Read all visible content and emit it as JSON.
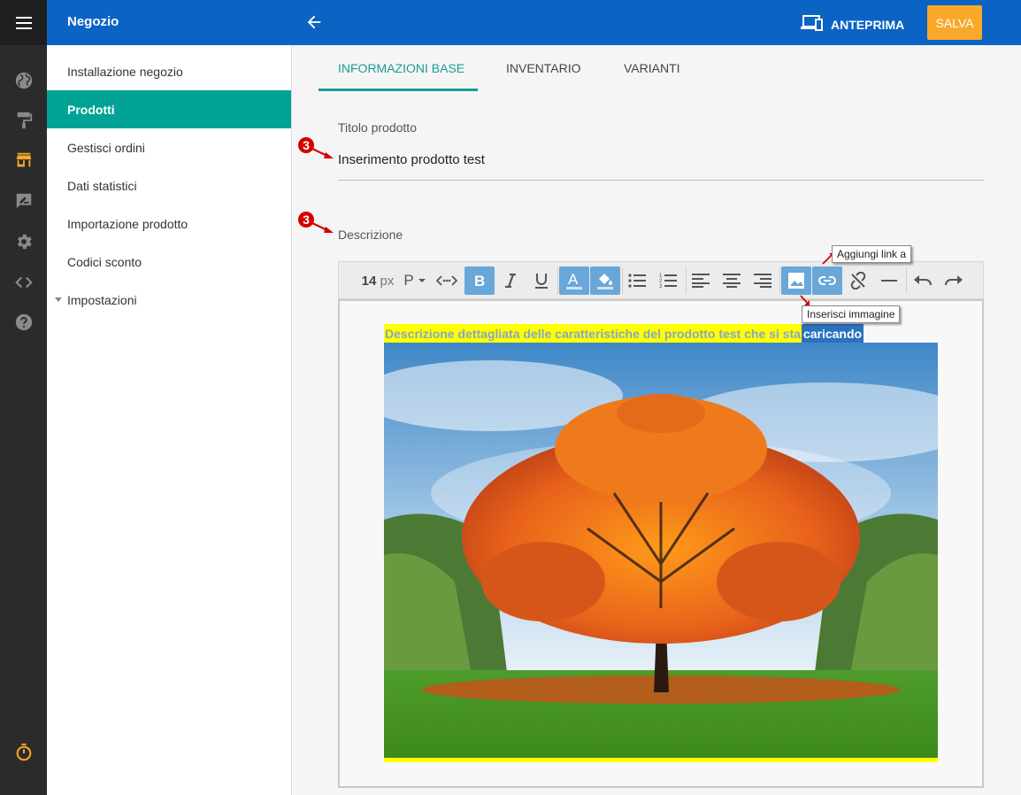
{
  "header": {
    "title": "Negozio",
    "preview_label": "ANTEPRIMA",
    "save_label": "SALVA"
  },
  "sidebar": {
    "items": [
      {
        "label": "Installazione negozio"
      },
      {
        "label": "Prodotti"
      },
      {
        "label": "Gestisci ordini"
      },
      {
        "label": "Dati statistici"
      },
      {
        "label": "Importazione prodotto"
      },
      {
        "label": "Codici sconto"
      },
      {
        "label": "Impostazioni"
      }
    ]
  },
  "tabs": [
    {
      "label": "INFORMAZIONI BASE"
    },
    {
      "label": "INVENTARIO"
    },
    {
      "label": "VARIANTI"
    }
  ],
  "form": {
    "title_label": "Titolo prodotto",
    "title_value": "Inserimento prodotto test",
    "description_label": "Descrizione"
  },
  "editor": {
    "font_size": "14",
    "font_unit": "px",
    "paragraph": "P",
    "text_highlighted": "Descrizione dettagliata delle caratteristiche del prodotto test che si sta",
    "text_selected": "caricando"
  },
  "annotations": {
    "marker": "3",
    "tooltip_link": "Aggiungi link a",
    "tooltip_image": "Inserisci immagine"
  },
  "colors": {
    "header": "#0b63c3",
    "accent": "#00a396",
    "save": "#f9a82a"
  }
}
